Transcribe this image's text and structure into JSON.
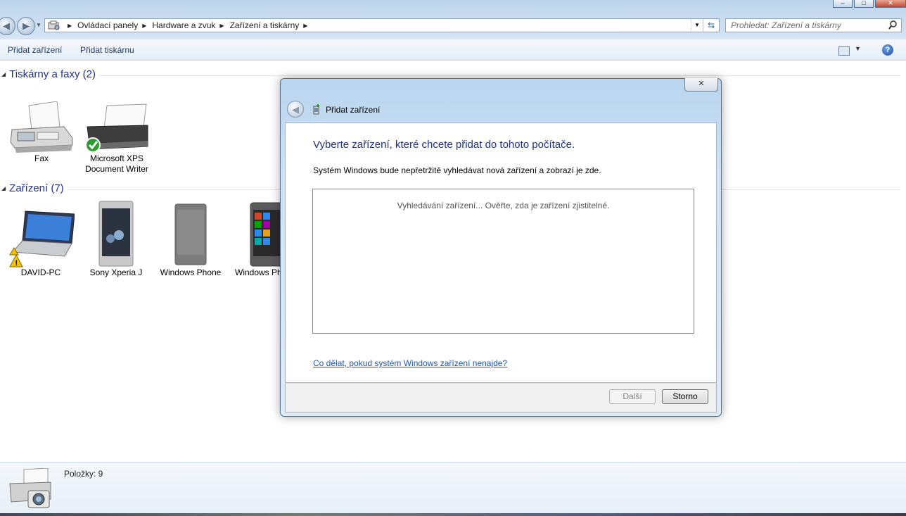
{
  "window": {
    "controls": [
      "minimize",
      "maximize",
      "close"
    ]
  },
  "address_bar": {
    "breadcrumbs": [
      "Ovládací panely",
      "Hardware a zvuk",
      "Zařízení a tiskárny"
    ]
  },
  "search": {
    "placeholder": "Prohledat: Zařízení a tiskárny"
  },
  "toolbar": {
    "add_device": "Přidat zařízení",
    "add_printer": "Přidat tiskárnu"
  },
  "groups": {
    "printers": {
      "title": "Tiskárny a faxy (2)",
      "items": [
        {
          "label": "Fax",
          "icon": "fax-icon"
        },
        {
          "label_line1": "Microsoft XPS",
          "label_line2": "Document Writer",
          "icon": "printer-default-icon"
        }
      ]
    },
    "devices": {
      "title": "Zařízení (7)",
      "items": [
        {
          "label": "DAVID-PC",
          "icon": "laptop-warning-icon"
        },
        {
          "label": "Sony Xperia J",
          "icon": "phone-icon"
        },
        {
          "label": "Windows Phone",
          "icon": "phone-icon"
        },
        {
          "label": "Windows Ph",
          "icon": "phone-icon"
        }
      ]
    }
  },
  "status": {
    "count": "Položky: 9"
  },
  "dialog": {
    "title": "Přidat zařízení",
    "heading": "Vyberte zařízení, které chcete přidat do tohoto počítače.",
    "description": "Systém Windows bude nepřetržitě vyhledávat nová zařízení a zobrazí je zde.",
    "searching_message": "Vyhledávání zařízení... Ověřte, zda je zařízení zjistitelné.",
    "help_link": "Co dělat, pokud systém Windows zařízení nenajde?",
    "buttons": {
      "next": "Další",
      "cancel": "Storno"
    }
  },
  "colors": {
    "heading_blue": "#1e3287",
    "link_blue": "#1b57b1",
    "chrome_blue": "#c9dcf0"
  }
}
